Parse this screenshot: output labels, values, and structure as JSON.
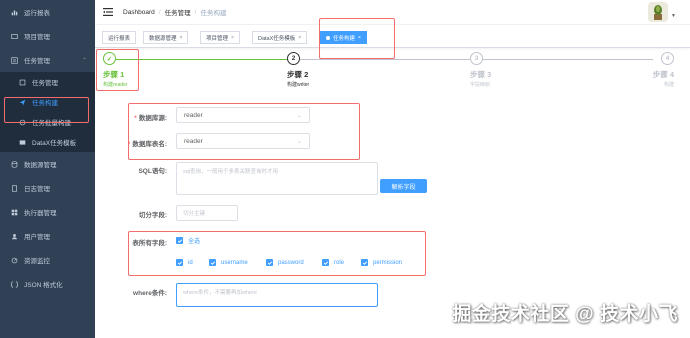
{
  "sidebar": {
    "items": [
      {
        "label": "运行报表",
        "icon": "chart-icon"
      },
      {
        "label": "项目管理",
        "icon": "folder-icon"
      },
      {
        "label": "任务管理",
        "icon": "task-icon",
        "expanded": true
      },
      {
        "label": "任务管理",
        "icon": "list-icon",
        "sub": true
      },
      {
        "label": "任务构建",
        "icon": "send-icon",
        "sub": true,
        "active": true
      },
      {
        "label": "任务批量构建",
        "icon": "batch-icon",
        "sub": true
      },
      {
        "label": "DataX任务模板",
        "icon": "template-icon",
        "sub": true
      },
      {
        "label": "数据源管理",
        "icon": "database-icon"
      },
      {
        "label": "日志管理",
        "icon": "log-icon"
      },
      {
        "label": "执行器管理",
        "icon": "executor-icon"
      },
      {
        "label": "用户管理",
        "icon": "user-icon"
      },
      {
        "label": "资源监控",
        "icon": "monitor-icon"
      },
      {
        "label": "JSON 格式化",
        "icon": "json-icon"
      }
    ]
  },
  "breadcrumb": {
    "home": "Dashboard",
    "level1": "任务管理",
    "level2": "任务构建"
  },
  "tags": [
    {
      "label": "运行报表",
      "closable": false
    },
    {
      "label": "数据源管理",
      "closable": true
    },
    {
      "label": "项目管理",
      "closable": true
    },
    {
      "label": "DataX任务模板",
      "closable": true
    },
    {
      "label": "任务构建",
      "closable": true,
      "active": true
    }
  ],
  "steps": [
    {
      "num": "✓",
      "title": "步骤 1",
      "desc": "构建reader",
      "status": "done"
    },
    {
      "num": "2",
      "title": "步骤 2",
      "desc": "构建writer",
      "status": "process"
    },
    {
      "num": "3",
      "title": "步骤 3",
      "desc": "字段映射",
      "status": "wait"
    },
    {
      "num": "4",
      "title": "步骤 4",
      "desc": "构建",
      "status": "wait"
    }
  ],
  "form": {
    "datasource_label": "数据库源:",
    "datasource_value": "reader",
    "table_label": "数据库表名:",
    "table_value": "reader",
    "sql_label": "SQL语句:",
    "sql_placeholder": "sql查询，一般用于多表关联查询时才用",
    "parse_button": "解析字段",
    "split_label": "切分字段:",
    "split_placeholder": "切分主键",
    "fields_label": "表所有字段:",
    "select_all": "全选",
    "fields": [
      "id",
      "username",
      "password",
      "role",
      "permission"
    ],
    "where_label": "where条件:",
    "where_placeholder": "where条件，不需要再加where"
  },
  "colors": {
    "primary": "#409eff",
    "success": "#67c23a",
    "sidebar": "#304156",
    "annotation": "#f56c6c"
  },
  "watermark": "掘金技术社区 @ 技术小飞"
}
